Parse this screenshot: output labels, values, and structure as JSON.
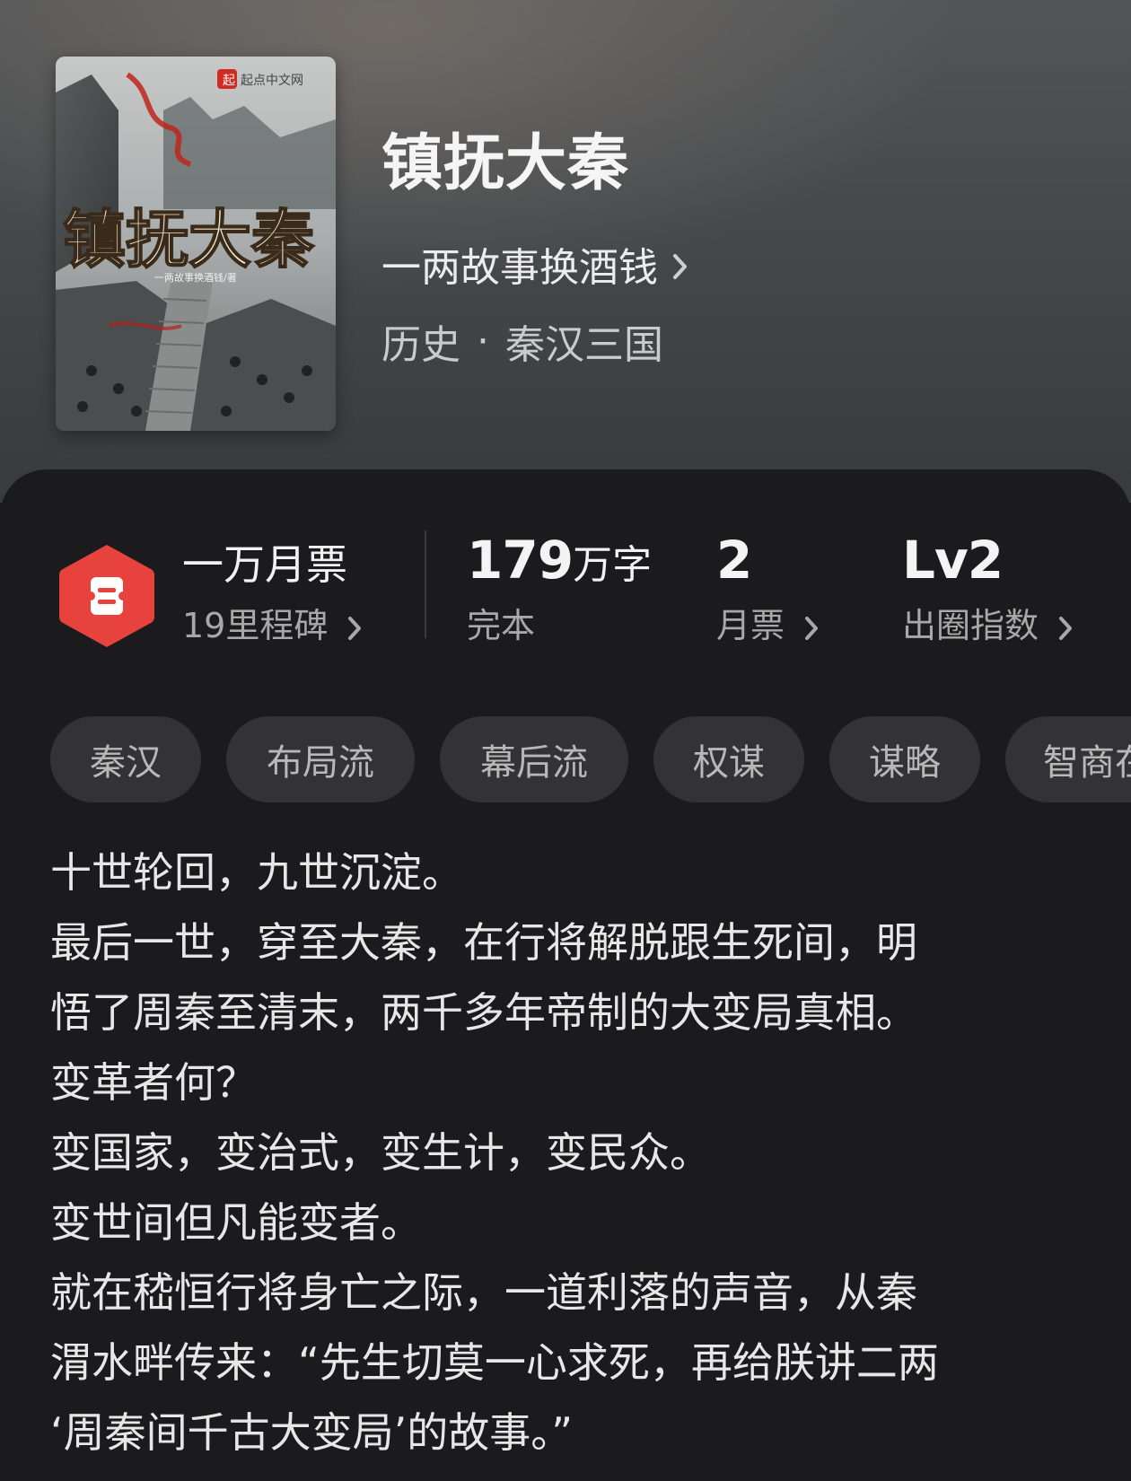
{
  "book": {
    "title": "镇抚大秦",
    "author": "一两故事换酒钱",
    "genre": "历史",
    "genre_separator": "·",
    "subgenre": "秦汉三国",
    "cover": {
      "publisher_mark": "起点中文网",
      "title_text": "镇抚大秦",
      "author_text": "一两故事换酒钱/著"
    }
  },
  "stats": {
    "milestone_title": "一万月票",
    "milestone_sub": "19里程碑",
    "word_count_number": "179",
    "word_count_unit": "万字",
    "status": "完本",
    "monthly_votes_value": "2",
    "monthly_votes_label": "月票",
    "breakout_value": "Lv2",
    "breakout_label": "出圈指数"
  },
  "tags": [
    "秦汉",
    "布局流",
    "幕后流",
    "权谋",
    "谋略",
    "智商在线"
  ],
  "description": [
    "十世轮回，九世沉淀。",
    "最后一世，穿至大秦，在行将解脱跟生死间，明",
    "悟了周秦至清末，两千多年帝制的大变局真相。",
    "变革者何？",
    "变国家，变治式，变生计，变民众。",
    "变世间但凡能变者。",
    "就在嵇恒行将身亡之际，一道利落的声音，从秦",
    "渭水畔传来：“先生切莫一心求死，再给朕讲二两",
    "‘周秦间千古大变局’的故事。”"
  ],
  "colors": {
    "badge": "#e8423f",
    "panel_bg": "#1b1b1d",
    "tag_bg": "#333335"
  },
  "icons": {
    "chevron": "chevron-right-icon",
    "badge": "ticket-badge-icon"
  }
}
